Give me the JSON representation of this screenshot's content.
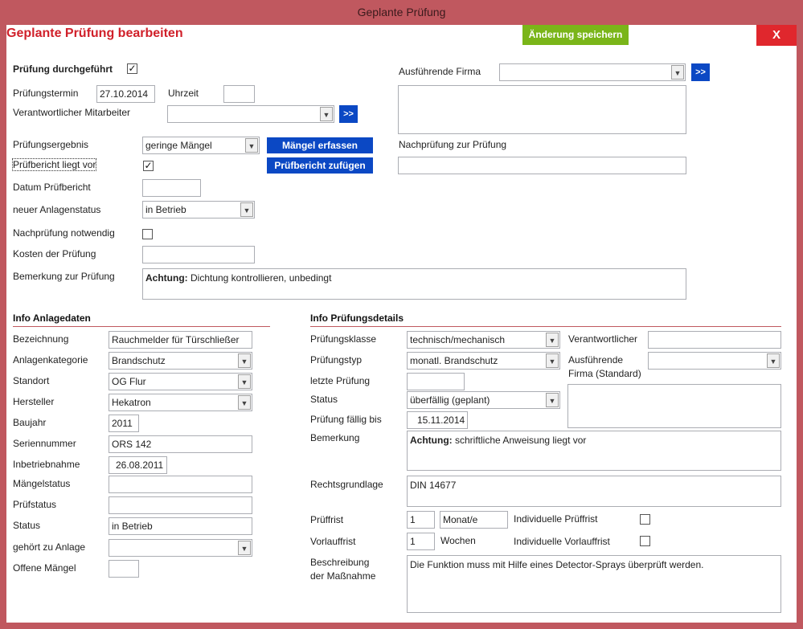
{
  "window": {
    "title": "Geplante Prüfung"
  },
  "header": {
    "title": "Geplante Prüfung bearbeiten",
    "save_label": "Änderung speichern",
    "close_label": "X"
  },
  "top": {
    "done_label": "Prüfung durchgeführt",
    "done_checked": "✓",
    "date_label": "Prüfungstermin",
    "date_value": "27.10.2014",
    "time_label": "Uhrzeit",
    "time_value": "",
    "employee_label": "Verantwortlicher Mitarbeiter",
    "employee_value": "",
    "firm_label": "Ausführende Firma",
    "firm_value": "",
    "result_label": "Prüfungsergebnis",
    "result_value": "geringe Mängel",
    "defects_button": "Mängel erfassen",
    "report_label": "Prüfbericht liegt vor",
    "report_checked": "✓",
    "report_button": "Prüfbericht  zufügen",
    "recheck_link_label": "Nachprüfung zur Prüfung",
    "recheck_link_value": "",
    "report_date_label": "Datum Prüfbericht",
    "report_date_value": "",
    "status_label": "neuer Anlagenstatus",
    "status_value": "in Betrieb",
    "recheck_needed_label": "Nachprüfung notwendig",
    "recheck_needed_checked": "",
    "cost_label": "Kosten der Prüfung",
    "cost_value": "",
    "remark_label": "Bemerkung zur Prüfung",
    "remark_bold": "Achtung:",
    "remark_text": " Dichtung kontrollieren, unbedingt",
    "arrow_label": ">>"
  },
  "anlage": {
    "heading": "Info Anlagedaten",
    "fields": [
      {
        "label": "Bezeichnung",
        "value": "Rauchmelder für Türschließer"
      },
      {
        "label": "Anlagenkategorie",
        "value": "Brandschutz"
      },
      {
        "label": "Standort",
        "value": "OG Flur"
      },
      {
        "label": "Hersteller",
        "value": "Hekatron"
      },
      {
        "label": "Baujahr",
        "value": "2011"
      },
      {
        "label": "Seriennummer",
        "value": "ORS 142"
      },
      {
        "label": "Inbetriebnahme",
        "value": "26.08.2011"
      },
      {
        "label": "Mängelstatus",
        "value": ""
      },
      {
        "label": "Prüfstatus",
        "value": ""
      },
      {
        "label": "Status",
        "value": "in Betrieb"
      },
      {
        "label": "gehört zu Anlage",
        "value": ""
      },
      {
        "label": "Offene Mängel",
        "value": ""
      }
    ]
  },
  "details": {
    "heading": "Info Prüfungsdetails",
    "class_label": "Prüfungsklasse",
    "class_value": "technisch/mechanisch",
    "type_label": "Prüfungstyp",
    "type_value": "monatl. Brandschutz",
    "last_label": "letzte Prüfung",
    "last_value": "",
    "status_label": "Status",
    "status_value": "überfällig (geplant)",
    "due_label": "Prüfung fällig bis",
    "due_value": "15.11.2014",
    "remark_label": "Bemerkung",
    "remark_bold": "Achtung:",
    "remark_text": " schriftliche Anweisung liegt vor",
    "legal_label": "Rechtsgrundlage",
    "legal_value": "DIN 14677",
    "interval_label": "Prüffrist",
    "interval_value": "1",
    "interval_unit": "Monat/e",
    "individual_interval_label": "Individuelle Prüffrist",
    "lead_label": "Vorlauffrist",
    "lead_value": "1",
    "lead_unit": "Wochen",
    "individual_lead_label": "Individuelle Vorlauffrist",
    "desc_label_1": "Beschreibung",
    "desc_label_2": "der Maßnahme",
    "desc_value": "Die Funktion muss mit Hilfe eines Detector-Sprays überprüft werden.",
    "responsible_label": "Verantwortlicher",
    "responsible_value": "",
    "firm_label_1": "Ausführende",
    "firm_label_2": "Firma (Standard)",
    "firm_value": ""
  },
  "colors": {
    "accent": "#c0585f",
    "title_red": "#d0202a",
    "button_blue": "#0b48c4",
    "button_green": "#7ab519",
    "close_red": "#e0272d"
  }
}
